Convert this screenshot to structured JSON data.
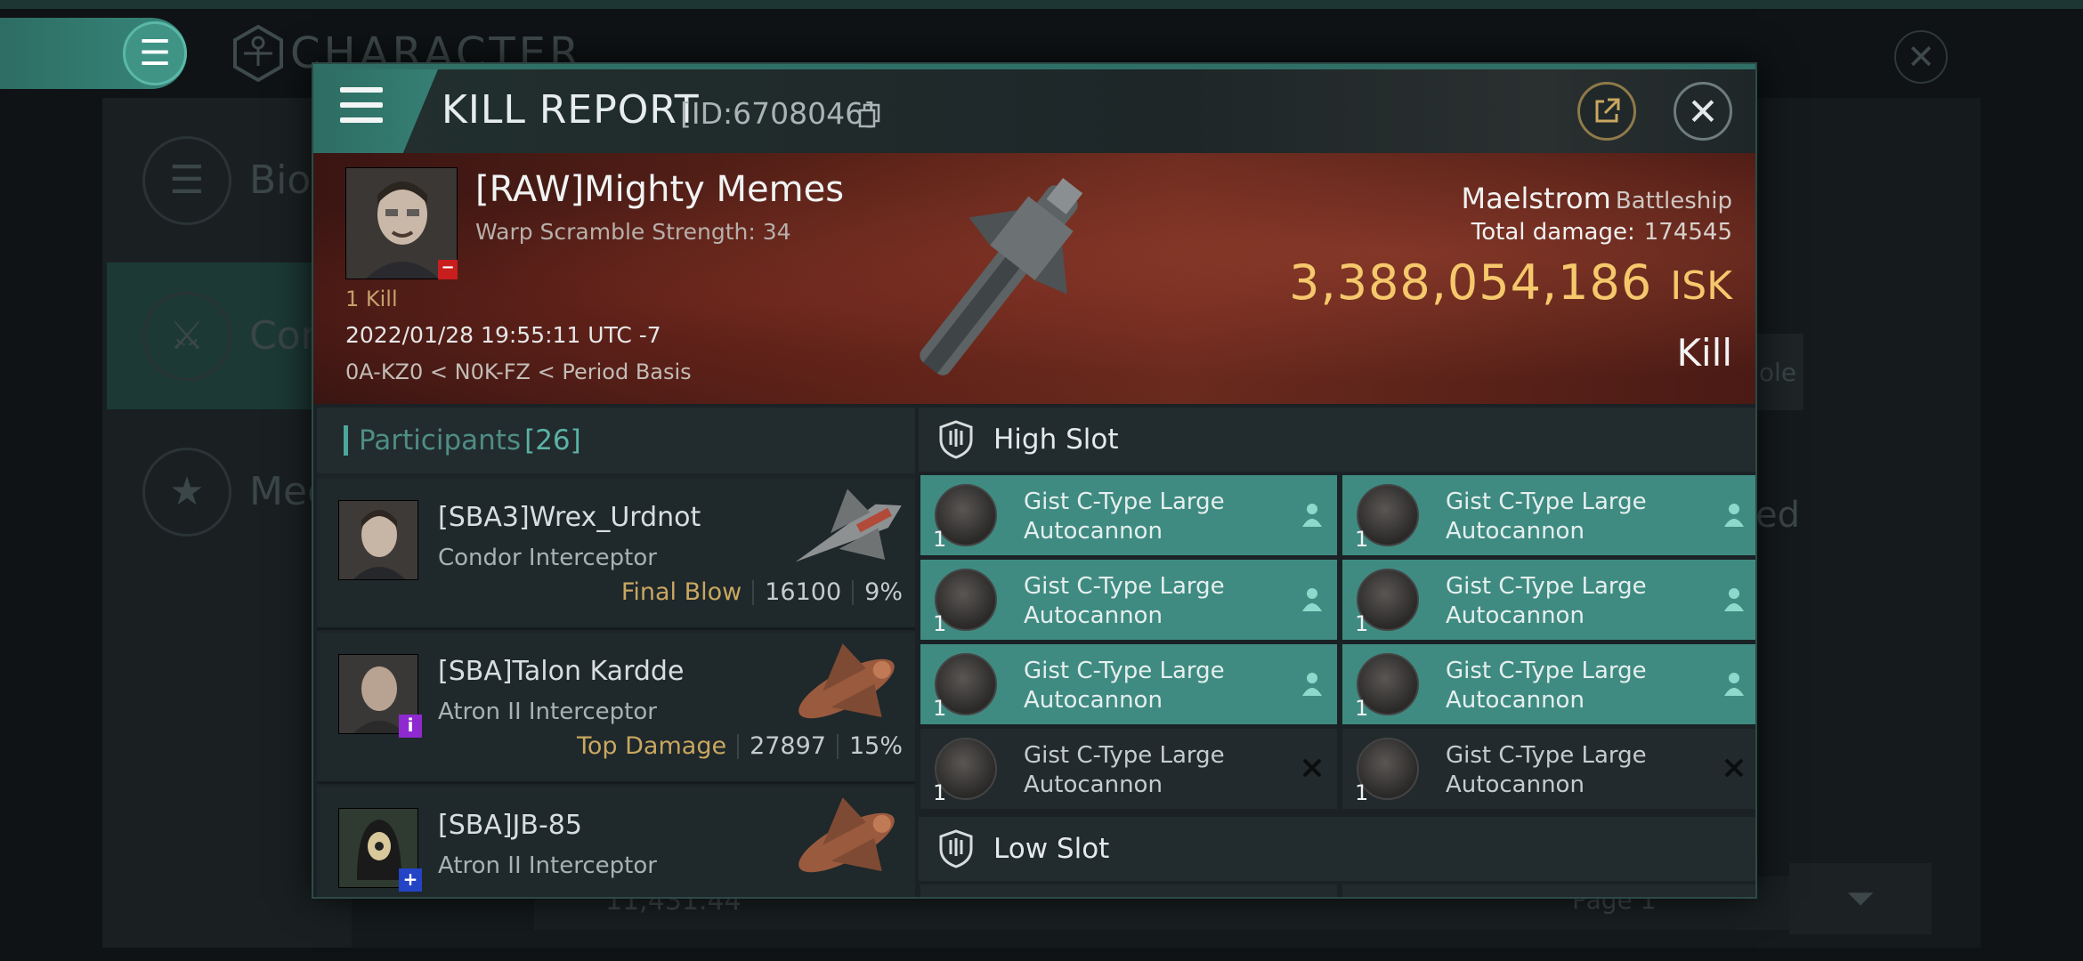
{
  "background": {
    "screen_title": "CHARACTER",
    "sidebar_items": [
      {
        "label": "Bio",
        "icon": "list-icon"
      },
      {
        "label": "Com",
        "icon": "swords-icon"
      },
      {
        "label": "Med",
        "icon": "star-icon"
      }
    ],
    "right_button_text": "ole",
    "right_text": "ed",
    "isk_text": "11,431.44",
    "page_text": "Page 1"
  },
  "kill_report": {
    "title": "KILL REPORT",
    "id_text": "[ID:6708046]",
    "victim": {
      "name": "[RAW]Mighty Memes",
      "scramble": "Warp Scramble Strength: 34",
      "kills": "1 Kill",
      "corp_badge": "−"
    },
    "time": "2022/01/28 19:55:11 UTC -7",
    "location": "0A-KZ0 < N0K-FZ < Period Basis",
    "ship": {
      "name": "Maelstrom",
      "class": "Battleship"
    },
    "total_damage_label": "Total damage:",
    "total_damage": "174545",
    "isk_value": "3,388,054,186",
    "isk_unit": "ISK",
    "result": "Kill"
  },
  "participants": {
    "label": "Participants",
    "count": "[26]",
    "rows": [
      {
        "name": "[SBA3]Wrex_Urdnot",
        "ship": "Condor Interceptor",
        "tag": "Final Blow",
        "damage": "16100",
        "percent": "9%",
        "badge": ""
      },
      {
        "name": "[SBA]Talon Kardde",
        "ship": "Atron II Interceptor",
        "tag": "Top Damage",
        "damage": "27897",
        "percent": "15%",
        "badge": "i"
      },
      {
        "name": "[SBA]JB-85",
        "ship": "Atron II Interceptor",
        "tag": "",
        "damage": "",
        "percent": "",
        "badge": "+"
      }
    ]
  },
  "slots": {
    "high_label": "High Slot",
    "low_label": "Low Slot",
    "high_items": [
      {
        "line1": "Gist C-Type Large",
        "line2": "Autocannon",
        "qty": "1",
        "status": "fitted"
      },
      {
        "line1": "Gist C-Type Large",
        "line2": "Autocannon",
        "qty": "1",
        "status": "fitted"
      },
      {
        "line1": "Gist C-Type Large",
        "line2": "Autocannon",
        "qty": "1",
        "status": "fitted"
      },
      {
        "line1": "Gist C-Type Large",
        "line2": "Autocannon",
        "qty": "1",
        "status": "fitted"
      },
      {
        "line1": "Gist C-Type Large",
        "line2": "Autocannon",
        "qty": "1",
        "status": "fitted"
      },
      {
        "line1": "Gist C-Type Large",
        "line2": "Autocannon",
        "qty": "1",
        "status": "fitted"
      },
      {
        "line1": "Gist C-Type Large",
        "line2": "Autocannon",
        "qty": "1",
        "status": "destroyed"
      },
      {
        "line1": "Gist C-Type Large",
        "line2": "Autocannon",
        "qty": "1",
        "status": "destroyed"
      }
    ],
    "status_icons": {
      "fitted": "person-icon",
      "destroyed": "x-icon"
    }
  },
  "colors": {
    "accent": "#3f8b81",
    "isk": "#f5c86c",
    "tag": "#c9a760",
    "banner": "#5b2218"
  }
}
